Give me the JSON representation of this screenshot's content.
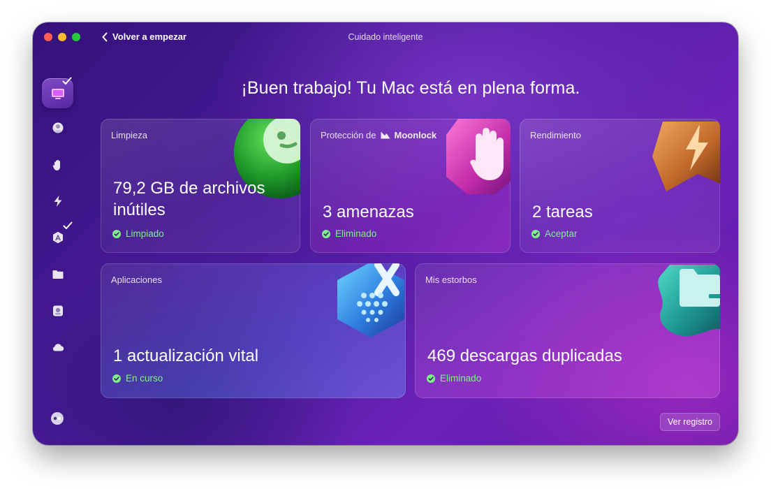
{
  "window": {
    "title": "Cuidado inteligente",
    "back_label": "Volver a empezar"
  },
  "sidebar": {
    "items": [
      {
        "name": "smart-care",
        "icon": "monitor-icon",
        "active": true,
        "checked": true
      },
      {
        "name": "cleanup",
        "icon": "globe-icon",
        "active": false,
        "checked": false
      },
      {
        "name": "protection",
        "icon": "hand-icon",
        "active": false,
        "checked": false
      },
      {
        "name": "performance",
        "icon": "lightning-icon",
        "active": false,
        "checked": false
      },
      {
        "name": "applications",
        "icon": "app-store-icon",
        "active": false,
        "checked": true
      },
      {
        "name": "my-clutter",
        "icon": "folder-icon",
        "active": false,
        "checked": false
      },
      {
        "name": "space-lens",
        "icon": "disk-icon",
        "active": false,
        "checked": false
      },
      {
        "name": "cloud",
        "icon": "cloud-icon",
        "active": false,
        "checked": false
      }
    ],
    "assistant_icon": "assistant-icon"
  },
  "main": {
    "heading": "¡Buen trabajo! Tu Mac está en plena forma.",
    "cards": {
      "cleanup": {
        "label": "Limpieza",
        "value_line1": "79,2 GB de archivos",
        "value_line2": "inútiles",
        "status": "Limpiado",
        "icon": "cleanup-globe-icon"
      },
      "protection": {
        "label": "Protección de",
        "brand": "Moonlock",
        "value": "3 amenazas",
        "status": "Eliminado",
        "icon": "protection-hand-icon"
      },
      "performance": {
        "label": "Rendimiento",
        "value": "2 tareas",
        "status": "Aceptar",
        "icon": "performance-lightning-icon"
      },
      "applications": {
        "label": "Aplicaciones",
        "value": "1 actualización vital",
        "status": "En curso",
        "icon": "applications-icon"
      },
      "clutter": {
        "label": "Mis estorbos",
        "value": "469 descargas duplicadas",
        "status": "Eliminado",
        "icon": "clutter-folder-icon"
      }
    },
    "view_log_label": "Ver registro"
  },
  "colors": {
    "status_green": "#7ff08a",
    "window_purple": "#4a1a9a"
  }
}
